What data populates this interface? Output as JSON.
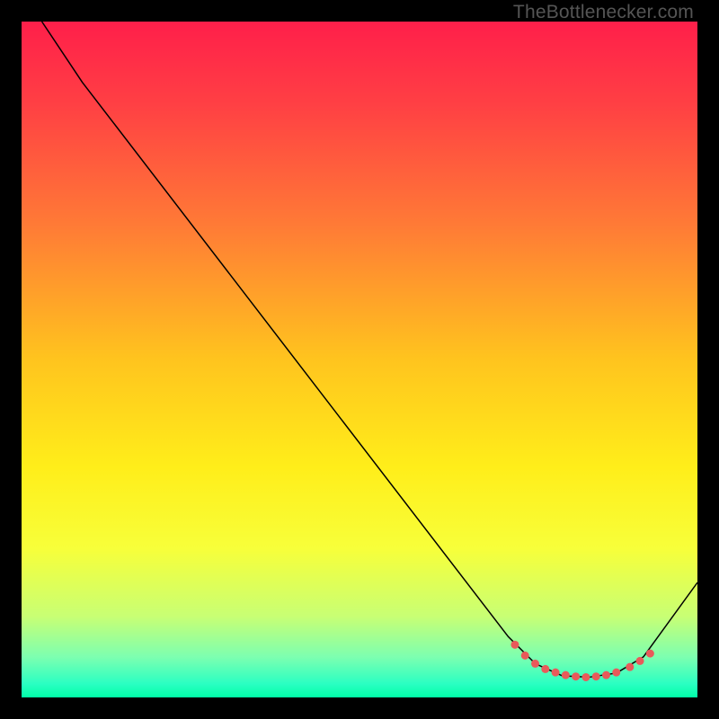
{
  "watermark": "TheBottlenecker.com",
  "chart_data": {
    "type": "line",
    "title": "",
    "xlabel": "",
    "ylabel": "",
    "xlim": [
      0,
      100
    ],
    "ylim": [
      0,
      100
    ],
    "background_gradient": {
      "stops": [
        {
          "offset": 0.0,
          "color": "#ff1f4a"
        },
        {
          "offset": 0.12,
          "color": "#ff3f44"
        },
        {
          "offset": 0.3,
          "color": "#ff7a36"
        },
        {
          "offset": 0.5,
          "color": "#ffc41e"
        },
        {
          "offset": 0.66,
          "color": "#ffee1a"
        },
        {
          "offset": 0.78,
          "color": "#f7ff3a"
        },
        {
          "offset": 0.88,
          "color": "#c8ff74"
        },
        {
          "offset": 0.94,
          "color": "#7dffb0"
        },
        {
          "offset": 0.98,
          "color": "#2affc2"
        },
        {
          "offset": 1.0,
          "color": "#00ffa8"
        }
      ]
    },
    "series": [
      {
        "name": "bottleneck-curve",
        "color": "#000000",
        "stroke_width": 1.5,
        "points": [
          {
            "x": 3.0,
            "y": 100.0
          },
          {
            "x": 9.0,
            "y": 91.0
          },
          {
            "x": 72.0,
            "y": 9.0
          },
          {
            "x": 76.0,
            "y": 5.0
          },
          {
            "x": 80.0,
            "y": 3.2
          },
          {
            "x": 84.0,
            "y": 3.0
          },
          {
            "x": 88.0,
            "y": 3.6
          },
          {
            "x": 92.0,
            "y": 6.0
          },
          {
            "x": 100.0,
            "y": 17.0
          }
        ]
      }
    ],
    "markers": {
      "name": "highlight-dots",
      "color": "#e85a5a",
      "radius": 4.5,
      "points": [
        {
          "x": 73.0,
          "y": 7.8
        },
        {
          "x": 74.5,
          "y": 6.2
        },
        {
          "x": 76.0,
          "y": 5.0
        },
        {
          "x": 77.5,
          "y": 4.2
        },
        {
          "x": 79.0,
          "y": 3.7
        },
        {
          "x": 80.5,
          "y": 3.3
        },
        {
          "x": 82.0,
          "y": 3.1
        },
        {
          "x": 83.5,
          "y": 3.0
        },
        {
          "x": 85.0,
          "y": 3.1
        },
        {
          "x": 86.5,
          "y": 3.3
        },
        {
          "x": 88.0,
          "y": 3.7
        },
        {
          "x": 90.0,
          "y": 4.5
        },
        {
          "x": 91.5,
          "y": 5.4
        },
        {
          "x": 93.0,
          "y": 6.5
        }
      ]
    }
  }
}
